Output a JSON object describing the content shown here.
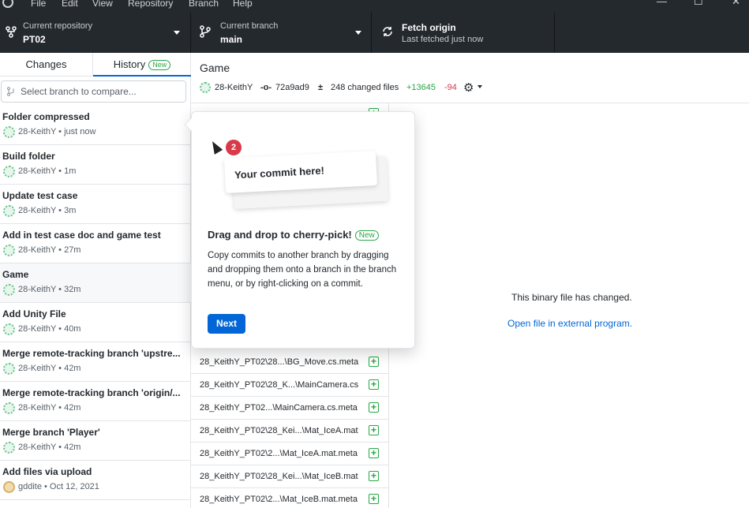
{
  "menubar": {
    "items": [
      "File",
      "Edit",
      "View",
      "Repository",
      "Branch",
      "Help"
    ]
  },
  "toolbar": {
    "repo_label": "Current repository",
    "repo_value": "PT02",
    "branch_label": "Current branch",
    "branch_value": "main",
    "fetch_label": "Fetch origin",
    "fetch_status": "Last fetched just now"
  },
  "sidebar": {
    "tabs": {
      "changes": "Changes",
      "history": "History",
      "history_badge": "New"
    },
    "compare_placeholder": "Select branch to compare...",
    "commits": [
      {
        "title": "Folder compressed",
        "meta": "28-KeithY • just now"
      },
      {
        "title": "Build folder",
        "meta": "28-KeithY • 1m"
      },
      {
        "title": "Update test case",
        "meta": "28-KeithY • 3m"
      },
      {
        "title": "Add in test case doc and game test",
        "meta": "28-KeithY • 27m"
      },
      {
        "title": "Game",
        "meta": "28-KeithY • 32m"
      },
      {
        "title": "Add Unity File",
        "meta": "28-KeithY • 40m"
      },
      {
        "title": "Merge remote-tracking branch 'upstre...",
        "meta": "28-KeithY • 42m"
      },
      {
        "title": "Merge remote-tracking branch 'origin/...",
        "meta": "28-KeithY • 42m"
      },
      {
        "title": "Merge branch 'Player'",
        "meta": "28-KeithY • 42m"
      },
      {
        "title": "Add files via upload",
        "meta": "gddite • Oct 12, 2021"
      }
    ]
  },
  "commit_detail": {
    "title": "Game",
    "author": "28-KeithY",
    "sha": "72a9ad9",
    "changed_files": "248 changed files",
    "additions": "+13645",
    "deletions": "-94"
  },
  "files": [
    "28_KeithY_PT02\\28...\\BG_Move.cs.meta",
    "28_KeithY_PT02\\28_K...\\MainCamera.cs",
    "28_KeithY_PT02...\\MainCamera.cs.meta",
    "28_KeithY_PT02\\28_Kei...\\Mat_IceA.mat",
    "28_KeithY_PT02\\2...\\Mat_IceA.mat.meta",
    "28_KeithY_PT02\\28_Kei...\\Mat_IceB.mat",
    "28_KeithY_PT02\\2...\\Mat_IceB.mat.meta"
  ],
  "diff": {
    "message": "This binary file has changed.",
    "link": "Open file in external program."
  },
  "popover": {
    "card_text": "Your commit here!",
    "count": "2",
    "title": "Drag and drop to cherry-pick!",
    "badge": "New",
    "body": "Copy commits to another branch by dragging and dropping them onto a branch in the branch menu, or by right-clicking on a commit.",
    "next": "Next"
  },
  "colors": {
    "accent": "#0366d6",
    "added": "#28a745",
    "deleted": "#d73a49",
    "toolbar_bg": "#24292e"
  }
}
